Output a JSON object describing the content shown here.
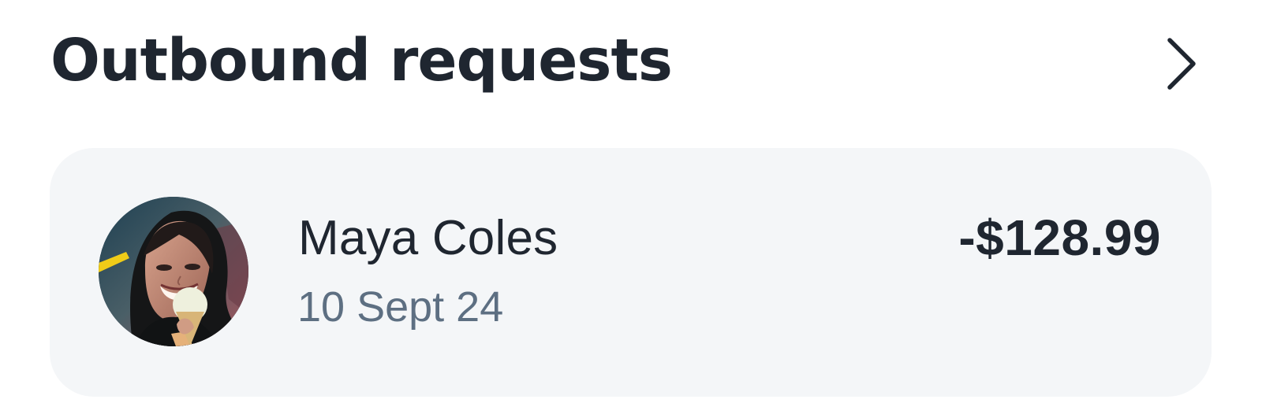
{
  "header": {
    "title": "Outbound requests",
    "action_icon": "chevron-right-icon"
  },
  "request": {
    "name": "Maya Coles",
    "date": "10 Sept 24",
    "amount": "-$128.99",
    "avatar_icon": "avatar-photo"
  },
  "colors": {
    "title": "#1f2630",
    "secondary_text": "#5d6f82",
    "card_background": "#f4f6f8"
  }
}
